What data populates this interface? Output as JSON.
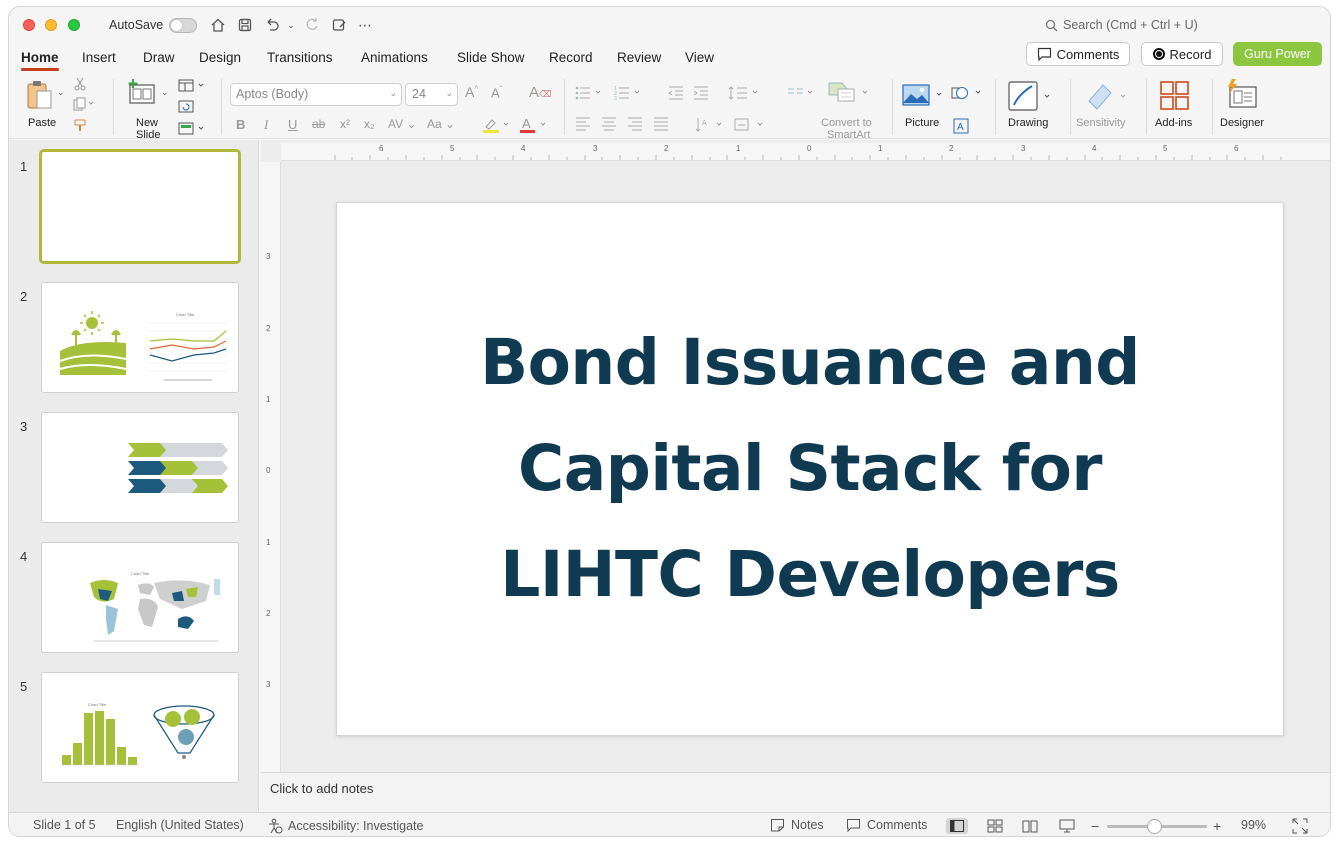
{
  "titlebar": {
    "autosave": "AutoSave",
    "search_placeholder": "Search (Cmd + Ctrl + U)"
  },
  "tabs": [
    "Home",
    "Insert",
    "Draw",
    "Design",
    "Transitions",
    "Animations",
    "Slide Show",
    "Record",
    "Review",
    "View"
  ],
  "actions": {
    "comments": "Comments",
    "record": "Record",
    "guru": "Guru Power"
  },
  "ribbon": {
    "paste": "Paste",
    "new_slide_1": "New",
    "new_slide_2": "Slide",
    "font_name": "Aptos (Body)",
    "font_size": "24",
    "convert_1": "Convert to",
    "convert_2": "SmartArt",
    "picture": "Picture",
    "drawing": "Drawing",
    "sensitivity": "Sensitivity",
    "addins": "Add-ins",
    "designer": "Designer"
  },
  "ruler": {
    "h": [
      "6",
      "5",
      "4",
      "3",
      "2",
      "1",
      "0",
      "1",
      "2",
      "3",
      "4",
      "5",
      "6"
    ],
    "v": [
      "3",
      "2",
      "1",
      "0",
      "1",
      "2",
      "3"
    ]
  },
  "thumbnails": [
    "1",
    "2",
    "3",
    "4",
    "5"
  ],
  "thumb_text": {
    "chart_title": "Chart Title"
  },
  "slide": {
    "title_line1": "Bond Issuance and",
    "title_line2": "Capital Stack for",
    "title_line3": "LIHTC Developers"
  },
  "notes": "Click to add notes",
  "status": {
    "slide_count": "Slide 1 of 5",
    "language": "English (United States)",
    "accessibility": "Accessibility: Investigate",
    "notes": "Notes",
    "comments": "Comments",
    "zoom": "99%"
  },
  "colors": {
    "accent": "#c43e1c",
    "guru": "#8cc63f",
    "title": "#0f3a52",
    "green": "#a5c13a",
    "blue": "#1d5a7e"
  }
}
